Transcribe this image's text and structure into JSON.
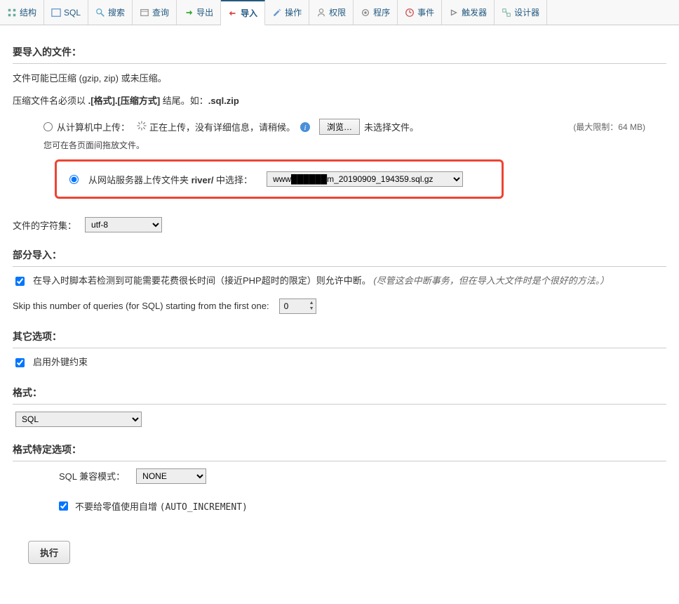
{
  "tabs": [
    {
      "label": "结构",
      "icon": "structure-icon"
    },
    {
      "label": "SQL",
      "icon": "sql-icon"
    },
    {
      "label": "搜索",
      "icon": "search-icon"
    },
    {
      "label": "查询",
      "icon": "query-icon"
    },
    {
      "label": "导出",
      "icon": "export-icon"
    },
    {
      "label": "导入",
      "icon": "import-icon",
      "active": true
    },
    {
      "label": "操作",
      "icon": "operation-icon"
    },
    {
      "label": "权限",
      "icon": "privileges-icon"
    },
    {
      "label": "程序",
      "icon": "routines-icon"
    },
    {
      "label": "事件",
      "icon": "events-icon"
    },
    {
      "label": "触发器",
      "icon": "triggers-icon"
    },
    {
      "label": "设计器",
      "icon": "designer-icon"
    }
  ],
  "sections": {
    "file_to_import": "要导入的文件：",
    "partial_import": "部分导入：",
    "other_options": "其它选项：",
    "format": "格式：",
    "format_specific": "格式特定选项："
  },
  "file_desc": {
    "line1a": "文件可能已压缩 (gzip, zip) 或未压缩。",
    "line2a": "压缩文件名必须以 ",
    "line2b": ".[格式].[压缩方式]",
    "line2c": " 结尾。如：",
    "line2d": ".sql.zip"
  },
  "upload": {
    "from_computer_label": "从计算机中上传：",
    "uploading_text": " 正在上传，没有详细信息，请稍候。",
    "browse_btn": "浏览…",
    "no_file": "未选择文件。",
    "limit": "(最大限制：64 MB)",
    "drag_note": "您可在各页面间拖放文件。"
  },
  "server_upload": {
    "label_a": "从网站服务器上传文件夹 ",
    "label_b": "river/",
    "label_c": " 中选择：",
    "selected": "www██████m_20190909_194359.sql.gz"
  },
  "charset": {
    "label": "文件的字符集：",
    "value": "utf-8"
  },
  "partial": {
    "allow_interrupt": "在导入时脚本若检测到可能需要花费很长时间（接近PHP超时的限定）则允许中断。",
    "allow_interrupt_italic": "(尽管这会中断事务，但在导入大文件时是个很好的方法。）",
    "skip_label": "Skip this number of queries (for SQL) starting from the first one:",
    "skip_value": "0"
  },
  "other": {
    "fk_label": "启用外键约束"
  },
  "format_select": {
    "value": "SQL"
  },
  "sqlmode": {
    "label": "SQL 兼容模式：",
    "value": "NONE"
  },
  "autoincr": {
    "label_a": "不要给零值使用自增",
    "label_b": "(AUTO_INCREMENT)"
  },
  "execute": "执行"
}
